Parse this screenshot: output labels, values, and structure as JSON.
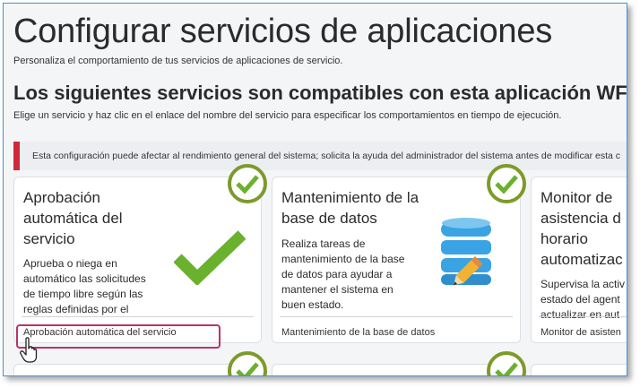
{
  "header": {
    "title": "Configurar servicios de aplicaciones",
    "subtitle": "Personaliza el comportamiento de tus servicios de aplicaciones de servicio."
  },
  "section": {
    "title": "Los siguientes servicios son compatibles con esta aplicación WFM.",
    "subtitle": "Elige un servicio y haz clic en el enlace del nombre del servicio para especificar los comportamientos en tiempo de ejecución."
  },
  "warning": {
    "text": "Esta configuración puede afectar al rendimiento general del sistema; solicita la ayuda del administrador del sistema antes de modificar esta c"
  },
  "cards": [
    {
      "title_lines": [
        "Aprobación",
        "automática del",
        "servicio"
      ],
      "desc_lines": [
        "Aprueba o niega en",
        "automático las solicitudes",
        "de tiempo libre según las",
        "reglas definidas por el"
      ],
      "link": "Aprobación automática del servicio",
      "icon": "checkmark-icon"
    },
    {
      "title_lines": [
        "Mantenimiento de la",
        "base de datos"
      ],
      "desc_lines": [
        "Realiza tareas de",
        "mantenimiento de la base",
        "de datos para ayudar a",
        "mantener el sistema en",
        "buen estado."
      ],
      "link": "Mantenimiento de la base de datos",
      "icon": "database-edit-icon"
    },
    {
      "title_lines": [
        "Monitor de",
        "asistencia d",
        "horario",
        "automatizac"
      ],
      "desc_lines": [
        "Supervisa la activ",
        "estado del agent",
        "actualizar en aut"
      ],
      "link": "Monitor de asisten",
      "icon": ""
    }
  ],
  "colors": {
    "accent_green": "#7d9a2a",
    "check_green": "#6ab12e",
    "warning_red": "#d0283a",
    "highlight_magenta": "#b8336a",
    "db_blue": "#3aa3e3"
  }
}
